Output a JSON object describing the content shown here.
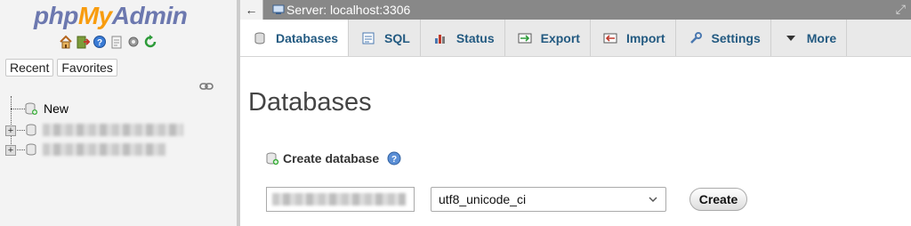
{
  "logo": {
    "part1": "php",
    "part2": "My",
    "part3": "Admin"
  },
  "nav_icons": [
    "home-icon",
    "logout-icon",
    "help-icon",
    "docs-icon",
    "settings-icon",
    "reload-icon"
  ],
  "nav_tabs": {
    "recent": "Recent",
    "favorites": "Favorites"
  },
  "tree": {
    "new_label": "New",
    "databases": [
      {
        "name_hidden": true
      },
      {
        "name_hidden": true
      }
    ]
  },
  "server_bar": {
    "back": "←",
    "label": "Server: localhost:3306"
  },
  "tabs": [
    {
      "label": "Databases",
      "icon": "database-icon",
      "active": true
    },
    {
      "label": "SQL",
      "icon": "sql-icon",
      "active": false
    },
    {
      "label": "Status",
      "icon": "status-icon",
      "active": false
    },
    {
      "label": "Export",
      "icon": "export-icon",
      "active": false
    },
    {
      "label": "Import",
      "icon": "import-icon",
      "active": false
    },
    {
      "label": "Settings",
      "icon": "wrench-icon",
      "active": false
    },
    {
      "label": "More",
      "icon": "caret-down-icon",
      "active": false
    }
  ],
  "main": {
    "title": "Databases",
    "create_label": "Create database",
    "db_name_value_hidden": true,
    "collation": "utf8_unicode_ci",
    "create_button": "Create"
  },
  "colors": {
    "link": "#235a81",
    "server_bar": "#888888",
    "tabs_bg": "#e9e9e9",
    "left_bg": "#f3f3f3"
  }
}
